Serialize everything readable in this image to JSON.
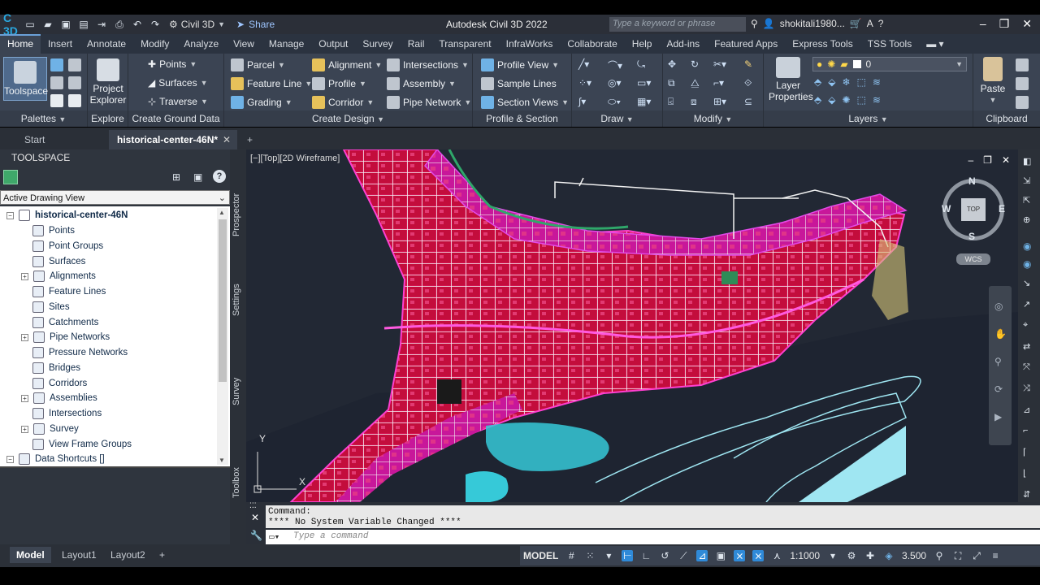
{
  "titlebar": {
    "app_logo": "C 3D",
    "workspace": "Civil 3D",
    "share": "Share",
    "title": "Autodesk Civil 3D 2022",
    "search_placeholder": "Type a keyword or phrase",
    "user": "shokitali1980..."
  },
  "menu": {
    "tabs": [
      "Home",
      "Insert",
      "Annotate",
      "Modify",
      "Analyze",
      "View",
      "Manage",
      "Output",
      "Survey",
      "Rail",
      "Transparent",
      "InfraWorks",
      "Collaborate",
      "Help",
      "Add-ins",
      "Featured Apps",
      "Express Tools",
      "TSS Tools"
    ]
  },
  "ribbon": {
    "toolspace": "Toolspace",
    "project_explorer_1": "Project",
    "project_explorer_2": "Explorer",
    "palettes": "Palettes",
    "explore": "Explore",
    "points": "Points",
    "surfaces": "Surfaces",
    "traverse": "Traverse",
    "create_ground_data": "Create Ground Data",
    "parcel": "Parcel",
    "feature_line": "Feature Line",
    "grading": "Grading",
    "alignment": "Alignment",
    "profile": "Profile",
    "corridor": "Corridor",
    "intersections": "Intersections",
    "assembly": "Assembly",
    "pipe_network": "Pipe Network",
    "create_design": "Create Design",
    "profile_view": "Profile View",
    "sample_lines": "Sample Lines",
    "section_views": "Section Views",
    "profile_section_views": "Profile & Section Views",
    "draw": "Draw",
    "modify": "Modify",
    "layer_value": "0",
    "layer_properties_1": "Layer",
    "layer_properties_2": "Properties",
    "layers": "Layers",
    "paste": "Paste",
    "clipboard": "Clipboard"
  },
  "doctabs": {
    "start": "Start",
    "active": "historical-center-46N*"
  },
  "toolspace": {
    "header": "TOOLSPACE",
    "view_select": "Active Drawing View",
    "root": "historical-center-46N",
    "items": [
      "Points",
      "Point Groups",
      "Surfaces",
      "Alignments",
      "Feature Lines",
      "Sites",
      "Catchments",
      "Pipe Networks",
      "Pressure Networks",
      "Bridges",
      "Corridors",
      "Assemblies",
      "Intersections",
      "Survey",
      "View Frame Groups"
    ],
    "data_shortcuts": "Data Shortcuts []"
  },
  "sidetabs": [
    "Prospector",
    "Settings",
    "Survey",
    "Toolbox"
  ],
  "viewport": {
    "label": "[−][Top][2D Wireframe]",
    "compass": {
      "n": "N",
      "s": "S",
      "e": "E",
      "w": "W",
      "top": "TOP",
      "wcs": "WCS"
    },
    "ucs_y": "Y",
    "ucs_x": "X"
  },
  "command": {
    "line1": "Command:",
    "line2": "**** No System Variable Changed ****",
    "input_placeholder": "Type a command"
  },
  "status": {
    "layouts": [
      "Model",
      "Layout1",
      "Layout2"
    ],
    "model": "MODEL",
    "scale": "1:1000",
    "annotation": "3.500"
  }
}
